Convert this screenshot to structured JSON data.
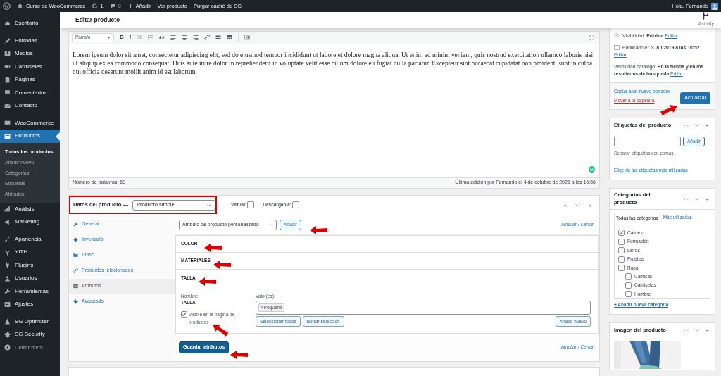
{
  "admin_bar": {
    "site": "Curso de WooCommerce",
    "updates": "1",
    "comments": "0",
    "new": "Añadir",
    "links": [
      "Ver producto",
      "Purgar caché de SG"
    ],
    "greeting": "Hola, Fernando"
  },
  "header": {
    "title": "Editar producto",
    "activity": "Activity"
  },
  "sidebar": {
    "groups": [
      {
        "items": [
          {
            "label": "Escritorio",
            "selected": false
          }
        ]
      },
      {
        "items": [
          {
            "label": "Entradas",
            "selected": false
          },
          {
            "label": "Medios",
            "selected": false
          },
          {
            "label": "Carruseles",
            "selected": false
          },
          {
            "label": "Páginas",
            "selected": false
          },
          {
            "label": "Comentarios",
            "selected": false
          },
          {
            "label": "Contacto",
            "selected": false
          }
        ]
      },
      {
        "items": [
          {
            "label": "WooCommerce",
            "selected": false
          },
          {
            "label": "Productos",
            "selected": true,
            "children": [
              {
                "label": "Todos los productos",
                "selected": true
              },
              {
                "label": "Añadir nuevo",
                "selected": false
              },
              {
                "label": "Categorías",
                "selected": false
              },
              {
                "label": "Etiquetas",
                "selected": false
              },
              {
                "label": "Atributos",
                "selected": false
              }
            ]
          },
          {
            "label": "Análisis",
            "selected": false
          },
          {
            "label": "Marketing",
            "selected": false
          }
        ]
      },
      {
        "items": [
          {
            "label": "Apariencia",
            "selected": false
          },
          {
            "label": "YITH",
            "selected": false
          },
          {
            "label": "Plugins",
            "selected": false
          },
          {
            "label": "Usuarios",
            "selected": false
          },
          {
            "label": "Herramientas",
            "selected": false
          },
          {
            "label": "Ajustes",
            "selected": false
          }
        ]
      },
      {
        "items": [
          {
            "label": "SG Optimizer",
            "selected": false
          },
          {
            "label": "SG Security",
            "selected": false
          }
        ]
      }
    ],
    "collapse": "Cerrar menú"
  },
  "editor": {
    "format": "Párrafo",
    "bold": "B",
    "italic": "I",
    "content": "Lorem ipsum dolor sit amet, consectetur adipiscing elit, sed do eiusmod tempor incididunt ut labore et dolore magna aliqua. Ut enim ad minim veniam, quis nostrud exercitation ullamco laboris nisi ut aliquip ex ea commodo consequat. Duis aute irure dolor in reprehenderit in voluptate velit esse cillum dolore eu fugiat nulla pariatur. Excepteur sint occaecat cupidatat non proident, sunt in culpa qui officia deserunt mollit anim id est laborum.",
    "word_count": "Número de palabras: 69",
    "last_edit": "Última edición por Fernando el 4 de octubre de 2021 a las 16:56"
  },
  "product_data": {
    "title": "Datos del producto —",
    "type": "Producto simple",
    "options": [
      {
        "label": "Virtual:",
        "checked": false
      },
      {
        "label": "Descargable:",
        "checked": false
      }
    ],
    "tabs": [
      {
        "label": "General",
        "selected": false
      },
      {
        "label": "Inventario",
        "selected": false
      },
      {
        "label": "Envío",
        "selected": false
      },
      {
        "label": "Productos relacionados",
        "selected": false
      },
      {
        "label": "Atributos",
        "selected": true
      },
      {
        "label": "Avanzado",
        "selected": false
      }
    ],
    "attribute_select": "Atributo de producto personalizado",
    "add": "Añadir",
    "toggle_links": [
      {
        "expand": "Ampliar",
        "separator": "/",
        "close": "Cerrar"
      },
      {
        "expand": "Ampliar",
        "separator": "/",
        "close": "Cerrar"
      }
    ],
    "attributes": [
      {
        "name": "COLOR",
        "expanded": false
      },
      {
        "name": "MATERIALES",
        "expanded": false
      },
      {
        "name": "TALLA",
        "expanded": true
      }
    ],
    "details": {
      "name_label": "Nombre:",
      "name": "TALLA",
      "visible_label": "Visible en la página de productos",
      "visible": true,
      "values_label": "Valor(es):",
      "tokens": [
        {
          "remove": "×",
          "label": "Pequeña"
        }
      ],
      "select_all": "Seleccionar todos",
      "clear": "Borrar selección",
      "add_new": "Añadir nuevo"
    },
    "save": "Guardar atributos"
  },
  "publish": {
    "lines": [
      {
        "text": "Visibilidad: **Pública**",
        "edit": "Editar"
      },
      {
        "text": "Publicado el: **3 Jul 2019 a las 10:52**",
        "edit": "Editar"
      },
      {
        "text": "Visibilidad catálogo: **En la tienda y en los resultados de búsqueda**",
        "edit": "Editar"
      }
    ],
    "copy": "Copiar a un nuevo borrador",
    "trash": "Mover a la papelera",
    "update": "Actualizar"
  },
  "tags": {
    "title": "Etiquetas del producto",
    "add": "Añadir",
    "hint": "Separar etiquetas con comas",
    "popular": "Elige de las etiquetas más utilizadas"
  },
  "categories": {
    "title": "Categorías del producto",
    "tabs": [
      {
        "label": "Todas las categorías",
        "selected": true
      },
      {
        "label": "Más utilizadas",
        "selected": false
      }
    ],
    "items": [
      {
        "label": "Calzado",
        "checked": true
      },
      {
        "label": "Formación",
        "checked": false
      },
      {
        "label": "Libros",
        "checked": false
      },
      {
        "label": "Pruebas",
        "checked": false
      },
      {
        "label": "Ropa",
        "checked": false,
        "children": [
          {
            "label": "Camisas",
            "checked": false
          },
          {
            "label": "Camisetas",
            "checked": false
          },
          {
            "label": "Hombre",
            "checked": false
          }
        ]
      }
    ],
    "add": "+ Añadir nueva categoría"
  },
  "image": {
    "title": "Imagen del producto",
    "kind": "picture"
  }
}
